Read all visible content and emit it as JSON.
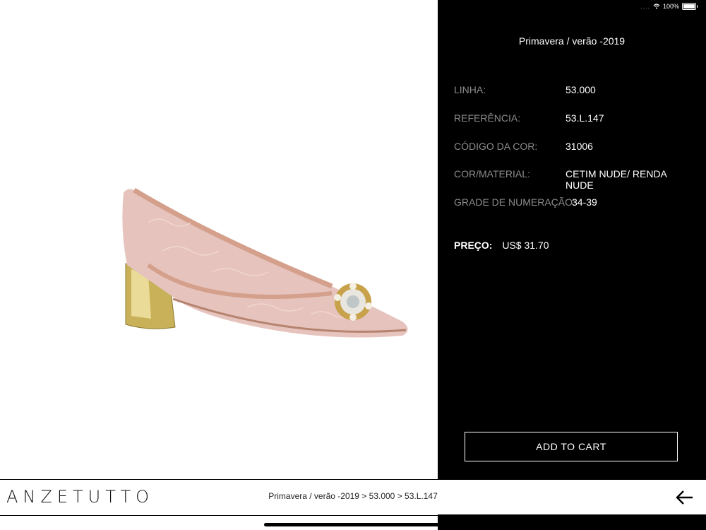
{
  "status": {
    "battery": "100%"
  },
  "product": {
    "collection": "Primavera / verão -2019",
    "specs": [
      {
        "label": "LINHA:",
        "value": "53.000"
      },
      {
        "label": "REFERÊNCIA:",
        "value": "53.L.147"
      },
      {
        "label": "CÓDIGO DA COR:",
        "value": "31006"
      },
      {
        "label": "COR/MATERIAL:",
        "value": "CETIM NUDE/ RENDA NUDE"
      },
      {
        "label": "GRADE DE NUMERAÇÃO:",
        "value": "34-39"
      }
    ],
    "price_label": "PREÇO:",
    "price_value": "US$ 31.70",
    "add_to_cart": "ADD TO CART"
  },
  "footer": {
    "brand": "ANZETUTTO",
    "breadcrumb": "Primavera / verão -2019 > 53.000 > 53.L.147"
  },
  "icons": {
    "back": "arrow-left-icon",
    "wifi": "wifi-icon",
    "battery": "battery-icon"
  },
  "colors": {
    "panel": "#000000",
    "label": "#8c8c8c",
    "background": "#ffffff"
  }
}
